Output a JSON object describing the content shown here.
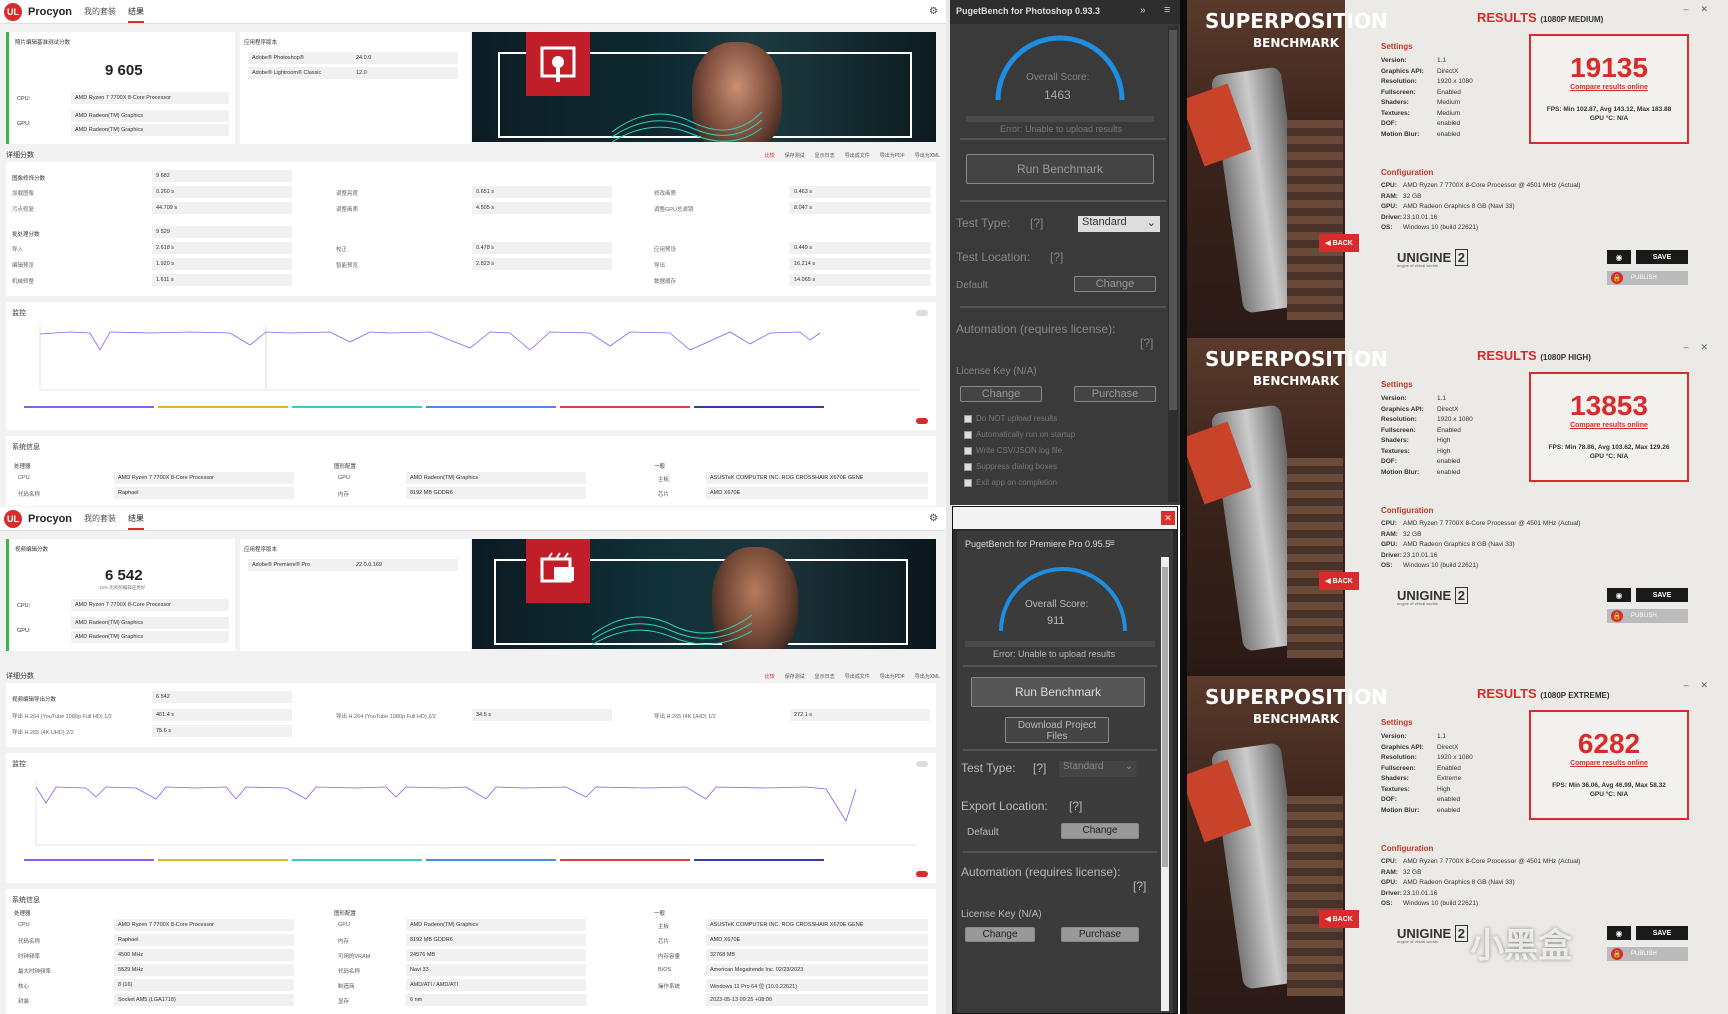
{
  "procyon1": {
    "brand": "Procyon",
    "tabs": [
      "我的套装",
      "结果"
    ],
    "score_title": "照片编辑基准测试分数",
    "score": "9 605",
    "cpu_label": "CPU:",
    "cpu_value": "AMD Ryzen 7 7700X 8-Core Processor",
    "gpu_label": "GPU:",
    "gpu_value1": "AMD Radeon(TM) Graphics",
    "gpu_value2": "AMD Radeon(TM) Graphics",
    "apps_title": "应用程序版本",
    "apps": [
      {
        "name": "Adobe® Photoshop®",
        "version": "24.0.0"
      },
      {
        "name": "Adobe® Lightroom® Classic",
        "version": "12.0"
      }
    ],
    "detail_title": "详细分数",
    "toolbar": [
      "比较",
      "保存测试",
      "显示日志",
      "导出成文件",
      "导出为PDF",
      "导出为XML"
    ],
    "group1_label": "图像修饰分数",
    "group1_score": "9 682",
    "group1_rows": [
      [
        "加载图像",
        "0.260 s",
        "调整亮度",
        "0.651 s",
        "修改画质",
        "0.463 s"
      ],
      [
        "污点修复",
        "44.709 s",
        "调整画质",
        "4.505 s",
        "调整GPU总滤镜",
        "8.047 s"
      ]
    ],
    "group2_label": "批处理分数",
    "group2_score": "9 529",
    "group2_rows": [
      [
        "导入",
        "2.618 s",
        "校正",
        "0.478 s",
        "应用预设",
        "0.449 s"
      ],
      [
        "编辑预览",
        "1.920 s",
        "智能预览",
        "2.823 s",
        "导出",
        "16.214 s"
      ],
      [
        "机械修整",
        "1.611 s",
        "",
        "",
        "数据缓存",
        "14.065 s"
      ]
    ],
    "monitor_title": "监控",
    "sysinfo_title": "系统信息",
    "sys_headers": [
      "处理器",
      "图形配置",
      "一般"
    ],
    "sys_rows": [
      [
        "CPU",
        "AMD Ryzen 7 7700X 8-Core Processor",
        "GPU",
        "AMD Radeon(TM) Graphics",
        "主板",
        "ASUSTeK COMPUTER INC. ROG CROSSHAIR X670E GENE"
      ],
      [
        "代码名称",
        "Raphael",
        "内存",
        "8192 MB GDDR6",
        "芯片",
        "AMD X670E"
      ]
    ]
  },
  "procyon2": {
    "brand": "Procyon",
    "tabs": [
      "我的套装",
      "结果"
    ],
    "score_title": "视频编辑分数",
    "score": "6 542",
    "score_sub": "10% 比视频编辑还更好",
    "cpu_label": "CPU:",
    "cpu_value": "AMD Ryzen 7 7700X 8-Core Processor",
    "gpu_label": "GPU:",
    "gpu_value1": "AMD Radeon(TM) Graphics",
    "gpu_value2": "AMD Radeon(TM) Graphics",
    "apps_title": "应用程序版本",
    "apps": [
      {
        "name": "Adobe® Premiere® Pro",
        "version": "22.0.0.169"
      }
    ],
    "detail_title": "详细分数",
    "toolbar": [
      "比较",
      "保存测试",
      "显示日志",
      "导出成文件",
      "导出为PDF",
      "导出为XML"
    ],
    "group1_label": "视频编辑导出分数",
    "group1_score": "6 542",
    "group1_rows": [
      [
        "导出 H.264 (YouTube 1080p Full HD) 1/2",
        "461.4 s",
        "导出 H.264 (YouTube 1080p Full HD) 2/2",
        "34.5 s",
        "导出 H.265 (4K UHD) 1/2",
        "272.1 s"
      ],
      [
        "导出 H.265 (4K UHD) 2/2",
        "75.6 s",
        "",
        "",
        "",
        ""
      ]
    ],
    "monitor_title": "监控",
    "sysinfo_title": "系统信息",
    "sys_headers": [
      "处理器",
      "图形配置",
      "一般"
    ],
    "sys_rows": [
      [
        "CPU",
        "AMD Ryzen 7 7700X 8-Core Processor",
        "GPU",
        "AMD Radeon(TM) Graphics",
        "主板",
        "ASUSTeK COMPUTER INC. ROG CROSSHAIR X670E GENE"
      ],
      [
        "代码名称",
        "Raphael",
        "内存",
        "8192 MB GDDR6",
        "芯片",
        "AMD X670E"
      ],
      [
        "时钟频率",
        "4500 MHz",
        "可用的VRAM",
        "24576 MB",
        "内存容量",
        "32768 MB"
      ],
      [
        "最大时钟频率",
        "5529 MHz",
        "代码名称",
        "Navi 33",
        "BIOS",
        "American Megatrends Inc. 02/23/2023"
      ],
      [
        "核心",
        "8 (16)",
        "制造商",
        "AMD/ATI / AMD/ATI",
        "操作系统",
        "Windows 11 Pro 64 位 (10.0.22621)"
      ],
      [
        "封装",
        "Socket AM5 (LGA1718)",
        "显存",
        "6 nm",
        "",
        "2023-05-13 09:25 +08:00"
      ]
    ]
  },
  "puget_ps": {
    "title": "PugetBench for Photoshop 0.93.3",
    "score_label": "Overall Score:",
    "score": "1463",
    "error": "Error: Unable to upload results",
    "run": "Run Benchmark",
    "test_type_label": "Test Type:",
    "help": "[?]",
    "test_type_value": "Standard",
    "test_location_label": "Test Location:",
    "default": "Default",
    "change": "Change",
    "automation_label": "Automation (requires license):",
    "license": "License Key (N/A)",
    "purchase": "Purchase",
    "checks": [
      "Do NOT upload results",
      "Automatically run on startup",
      "Write CSV/JSON log file",
      "Suppress dialog boxes",
      "Exit app on completion"
    ]
  },
  "puget_pr": {
    "title": "PugetBench for Premiere Pro 0.95.5",
    "score_label": "Overall Score:",
    "score": "911",
    "error": "Error: Unable to upload results",
    "run": "Run Benchmark",
    "download": "Download Project Files",
    "test_type_label": "Test Type:",
    "help": "[?]",
    "test_type_value": "Standard",
    "export_label": "Export Location:",
    "default": "Default",
    "change": "Change",
    "automation_label": "Automation (requires license):",
    "license": "License Key (N/A)",
    "purchase": "Purchase"
  },
  "superposition": {
    "title": "SUPERPOSITION",
    "subtitle": "BENCHMARK",
    "back": "BACK",
    "results_label": "RESULTS",
    "settings_title": "Settings",
    "config_title": "Configuration",
    "compare": "Compare results online",
    "save": "SAVE",
    "publish": "PUBLISH",
    "engine": "UNIGINE",
    "engine_ver": "2",
    "engine_sub": "engine of virtual worlds",
    "runs": [
      {
        "preset": "(1080P MEDIUM)",
        "score": "19135",
        "fps": "FPS: Min 102.87, Avg 143.12, Max 183.88",
        "gpu_temp": "GPU °C: N/A",
        "settings": [
          [
            "Version:",
            "1.1"
          ],
          [
            "Graphics API:",
            "DirectX"
          ],
          [
            "Resolution:",
            "1920 x 1080"
          ],
          [
            "Fullscreen:",
            "Enabled"
          ],
          [
            "Shaders:",
            "Medium"
          ],
          [
            "Textures:",
            "Medium"
          ],
          [
            "DOF:",
            "enabled"
          ],
          [
            "Motion Blur:",
            "enabled"
          ]
        ],
        "config": [
          [
            "CPU:",
            "AMD Ryzen 7 7700X 8-Core Processor @ 4501 MHz (Actual)"
          ],
          [
            "RAM:",
            "32 GB"
          ],
          [
            "GPU:",
            "AMD Radeon Graphics 8 GB (Navi 33)"
          ],
          [
            "Driver:",
            "23.10.01.16"
          ],
          [
            "OS:",
            "Windows 10 (build 22621)"
          ]
        ]
      },
      {
        "preset": "(1080P HIGH)",
        "score": "13853",
        "fps": "FPS: Min 78.86, Avg 103.62, Max 129.26",
        "gpu_temp": "GPU °C: N/A",
        "settings": [
          [
            "Version:",
            "1.1"
          ],
          [
            "Graphics API:",
            "DirectX"
          ],
          [
            "Resolution:",
            "1920 x 1080"
          ],
          [
            "Fullscreen:",
            "Enabled"
          ],
          [
            "Shaders:",
            "High"
          ],
          [
            "Textures:",
            "High"
          ],
          [
            "DOF:",
            "enabled"
          ],
          [
            "Motion Blur:",
            "enabled"
          ]
        ],
        "config": [
          [
            "CPU:",
            "AMD Ryzen 7 7700X 8-Core Processor @ 4501 MHz (Actual)"
          ],
          [
            "RAM:",
            "32 GB"
          ],
          [
            "GPU:",
            "AMD Radeon Graphics 8 GB (Navi 33)"
          ],
          [
            "Driver:",
            "23.10.01.16"
          ],
          [
            "OS:",
            "Windows 10 (build 22621)"
          ]
        ]
      },
      {
        "preset": "(1080P EXTREME)",
        "score": "6282",
        "fps": "FPS: Min 36.06, Avg 46.99, Max 58.32",
        "gpu_temp": "GPU °C: N/A",
        "settings": [
          [
            "Version:",
            "1.1"
          ],
          [
            "Graphics API:",
            "DirectX"
          ],
          [
            "Resolution:",
            "1920 x 1080"
          ],
          [
            "Fullscreen:",
            "Enabled"
          ],
          [
            "Shaders:",
            "Extreme"
          ],
          [
            "Textures:",
            "High"
          ],
          [
            "DOF:",
            "enabled"
          ],
          [
            "Motion Blur:",
            "enabled"
          ]
        ],
        "config": [
          [
            "CPU:",
            "AMD Ryzen 7 7700X 8-Core Processor @ 4501 MHz (Actual)"
          ],
          [
            "RAM:",
            "32 GB"
          ],
          [
            "GPU:",
            "AMD Radeon Graphics 8 GB (Navi 33)"
          ],
          [
            "Driver:",
            "23.10.01.16"
          ],
          [
            "OS:",
            "Windows 10 (build 22621)"
          ]
        ]
      }
    ]
  },
  "watermark": "小黑盒"
}
